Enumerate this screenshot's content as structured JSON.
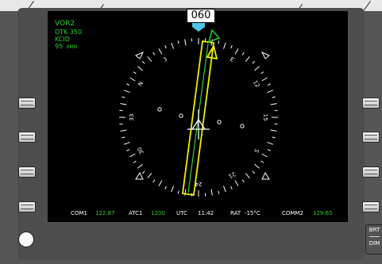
{
  "nav": {
    "source": "VOR2",
    "desired_track": "DTK 350",
    "waypoint": "KCID",
    "distance": "95",
    "distance_unit": ".0MN"
  },
  "heading": "060",
  "compass": {
    "labels": [
      "N",
      "3",
      "E",
      "12",
      "15",
      "S",
      "21",
      "24",
      "30",
      "33"
    ]
  },
  "status_bar": {
    "com1_label": "COM1",
    "com1_freq": "122.87",
    "atc1_label": "ATC1",
    "atc1_code": "1200",
    "utc_label": "UTC",
    "utc_time": "11:42",
    "rat_label": "RAT",
    "rat_value": "-15°C",
    "com2_label": "COMM2",
    "com2_freq": "129.65"
  },
  "controls": {
    "brt_label": "BRT",
    "dim_label": "DIM"
  },
  "colors": {
    "nav_text": "#2ed12e",
    "course_needle": "#f0f000",
    "heading_bug": "#4cc3e8"
  }
}
